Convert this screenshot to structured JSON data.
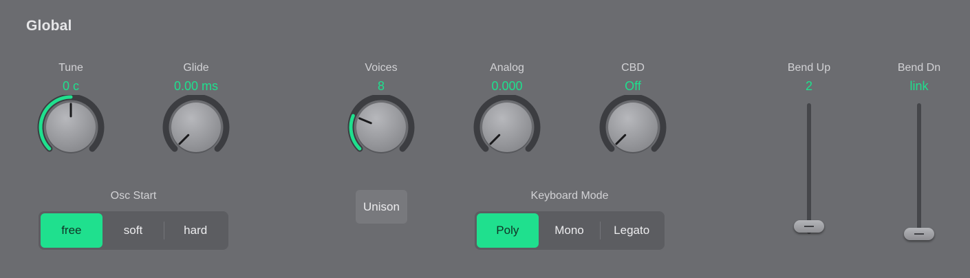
{
  "section": {
    "title": "Global"
  },
  "knobs": {
    "tune": {
      "label": "Tune",
      "value": "0  c",
      "position": 0.5
    },
    "glide": {
      "label": "Glide",
      "value": "0.00 ms",
      "position": 0.0
    },
    "voices": {
      "label": "Voices",
      "value": "8",
      "position": 0.25
    },
    "analog": {
      "label": "Analog",
      "value": "0.000",
      "position": 0.0
    },
    "cbd": {
      "label": "CBD",
      "value": "Off",
      "position": 0.0
    }
  },
  "osc_start": {
    "label": "Osc Start",
    "options": [
      "free",
      "soft",
      "hard"
    ],
    "selected": "free"
  },
  "unison": {
    "label": "Unison"
  },
  "keyboard_mode": {
    "label": "Keyboard Mode",
    "options": [
      "Poly",
      "Mono",
      "Legato"
    ],
    "selected": "Poly"
  },
  "bend_up": {
    "label": "Bend Up",
    "value": "2"
  },
  "bend_dn": {
    "label": "Bend Dn",
    "value": "link"
  },
  "colors": {
    "accent": "#1fe08e",
    "background": "#6b6c70",
    "label": "#d2d2d5"
  }
}
